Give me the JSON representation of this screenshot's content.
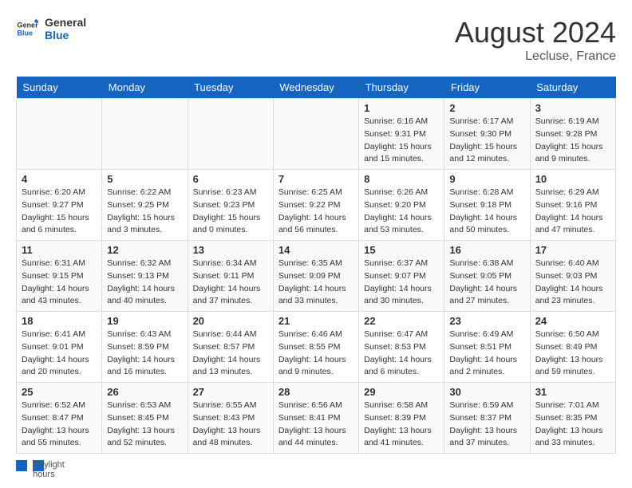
{
  "header": {
    "logo_general": "General",
    "logo_blue": "Blue",
    "title": "August 2024",
    "subtitle": "Lecluse, France"
  },
  "days_of_week": [
    "Sunday",
    "Monday",
    "Tuesday",
    "Wednesday",
    "Thursday",
    "Friday",
    "Saturday"
  ],
  "weeks": [
    [
      {
        "day": "",
        "info": ""
      },
      {
        "day": "",
        "info": ""
      },
      {
        "day": "",
        "info": ""
      },
      {
        "day": "",
        "info": ""
      },
      {
        "day": "1",
        "info": "Sunrise: 6:16 AM\nSunset: 9:31 PM\nDaylight: 15 hours and 15 minutes."
      },
      {
        "day": "2",
        "info": "Sunrise: 6:17 AM\nSunset: 9:30 PM\nDaylight: 15 hours and 12 minutes."
      },
      {
        "day": "3",
        "info": "Sunrise: 6:19 AM\nSunset: 9:28 PM\nDaylight: 15 hours and 9 minutes."
      }
    ],
    [
      {
        "day": "4",
        "info": "Sunrise: 6:20 AM\nSunset: 9:27 PM\nDaylight: 15 hours and 6 minutes."
      },
      {
        "day": "5",
        "info": "Sunrise: 6:22 AM\nSunset: 9:25 PM\nDaylight: 15 hours and 3 minutes."
      },
      {
        "day": "6",
        "info": "Sunrise: 6:23 AM\nSunset: 9:23 PM\nDaylight: 15 hours and 0 minutes."
      },
      {
        "day": "7",
        "info": "Sunrise: 6:25 AM\nSunset: 9:22 PM\nDaylight: 14 hours and 56 minutes."
      },
      {
        "day": "8",
        "info": "Sunrise: 6:26 AM\nSunset: 9:20 PM\nDaylight: 14 hours and 53 minutes."
      },
      {
        "day": "9",
        "info": "Sunrise: 6:28 AM\nSunset: 9:18 PM\nDaylight: 14 hours and 50 minutes."
      },
      {
        "day": "10",
        "info": "Sunrise: 6:29 AM\nSunset: 9:16 PM\nDaylight: 14 hours and 47 minutes."
      }
    ],
    [
      {
        "day": "11",
        "info": "Sunrise: 6:31 AM\nSunset: 9:15 PM\nDaylight: 14 hours and 43 minutes."
      },
      {
        "day": "12",
        "info": "Sunrise: 6:32 AM\nSunset: 9:13 PM\nDaylight: 14 hours and 40 minutes."
      },
      {
        "day": "13",
        "info": "Sunrise: 6:34 AM\nSunset: 9:11 PM\nDaylight: 14 hours and 37 minutes."
      },
      {
        "day": "14",
        "info": "Sunrise: 6:35 AM\nSunset: 9:09 PM\nDaylight: 14 hours and 33 minutes."
      },
      {
        "day": "15",
        "info": "Sunrise: 6:37 AM\nSunset: 9:07 PM\nDaylight: 14 hours and 30 minutes."
      },
      {
        "day": "16",
        "info": "Sunrise: 6:38 AM\nSunset: 9:05 PM\nDaylight: 14 hours and 27 minutes."
      },
      {
        "day": "17",
        "info": "Sunrise: 6:40 AM\nSunset: 9:03 PM\nDaylight: 14 hours and 23 minutes."
      }
    ],
    [
      {
        "day": "18",
        "info": "Sunrise: 6:41 AM\nSunset: 9:01 PM\nDaylight: 14 hours and 20 minutes."
      },
      {
        "day": "19",
        "info": "Sunrise: 6:43 AM\nSunset: 8:59 PM\nDaylight: 14 hours and 16 minutes."
      },
      {
        "day": "20",
        "info": "Sunrise: 6:44 AM\nSunset: 8:57 PM\nDaylight: 14 hours and 13 minutes."
      },
      {
        "day": "21",
        "info": "Sunrise: 6:46 AM\nSunset: 8:55 PM\nDaylight: 14 hours and 9 minutes."
      },
      {
        "day": "22",
        "info": "Sunrise: 6:47 AM\nSunset: 8:53 PM\nDaylight: 14 hours and 6 minutes."
      },
      {
        "day": "23",
        "info": "Sunrise: 6:49 AM\nSunset: 8:51 PM\nDaylight: 14 hours and 2 minutes."
      },
      {
        "day": "24",
        "info": "Sunrise: 6:50 AM\nSunset: 8:49 PM\nDaylight: 13 hours and 59 minutes."
      }
    ],
    [
      {
        "day": "25",
        "info": "Sunrise: 6:52 AM\nSunset: 8:47 PM\nDaylight: 13 hours and 55 minutes."
      },
      {
        "day": "26",
        "info": "Sunrise: 6:53 AM\nSunset: 8:45 PM\nDaylight: 13 hours and 52 minutes."
      },
      {
        "day": "27",
        "info": "Sunrise: 6:55 AM\nSunset: 8:43 PM\nDaylight: 13 hours and 48 minutes."
      },
      {
        "day": "28",
        "info": "Sunrise: 6:56 AM\nSunset: 8:41 PM\nDaylight: 13 hours and 44 minutes."
      },
      {
        "day": "29",
        "info": "Sunrise: 6:58 AM\nSunset: 8:39 PM\nDaylight: 13 hours and 41 minutes."
      },
      {
        "day": "30",
        "info": "Sunrise: 6:59 AM\nSunset: 8:37 PM\nDaylight: 13 hours and 37 minutes."
      },
      {
        "day": "31",
        "info": "Sunrise: 7:01 AM\nSunset: 8:35 PM\nDaylight: 13 hours and 33 minutes."
      }
    ]
  ],
  "footer": {
    "label": "Daylight hours"
  }
}
